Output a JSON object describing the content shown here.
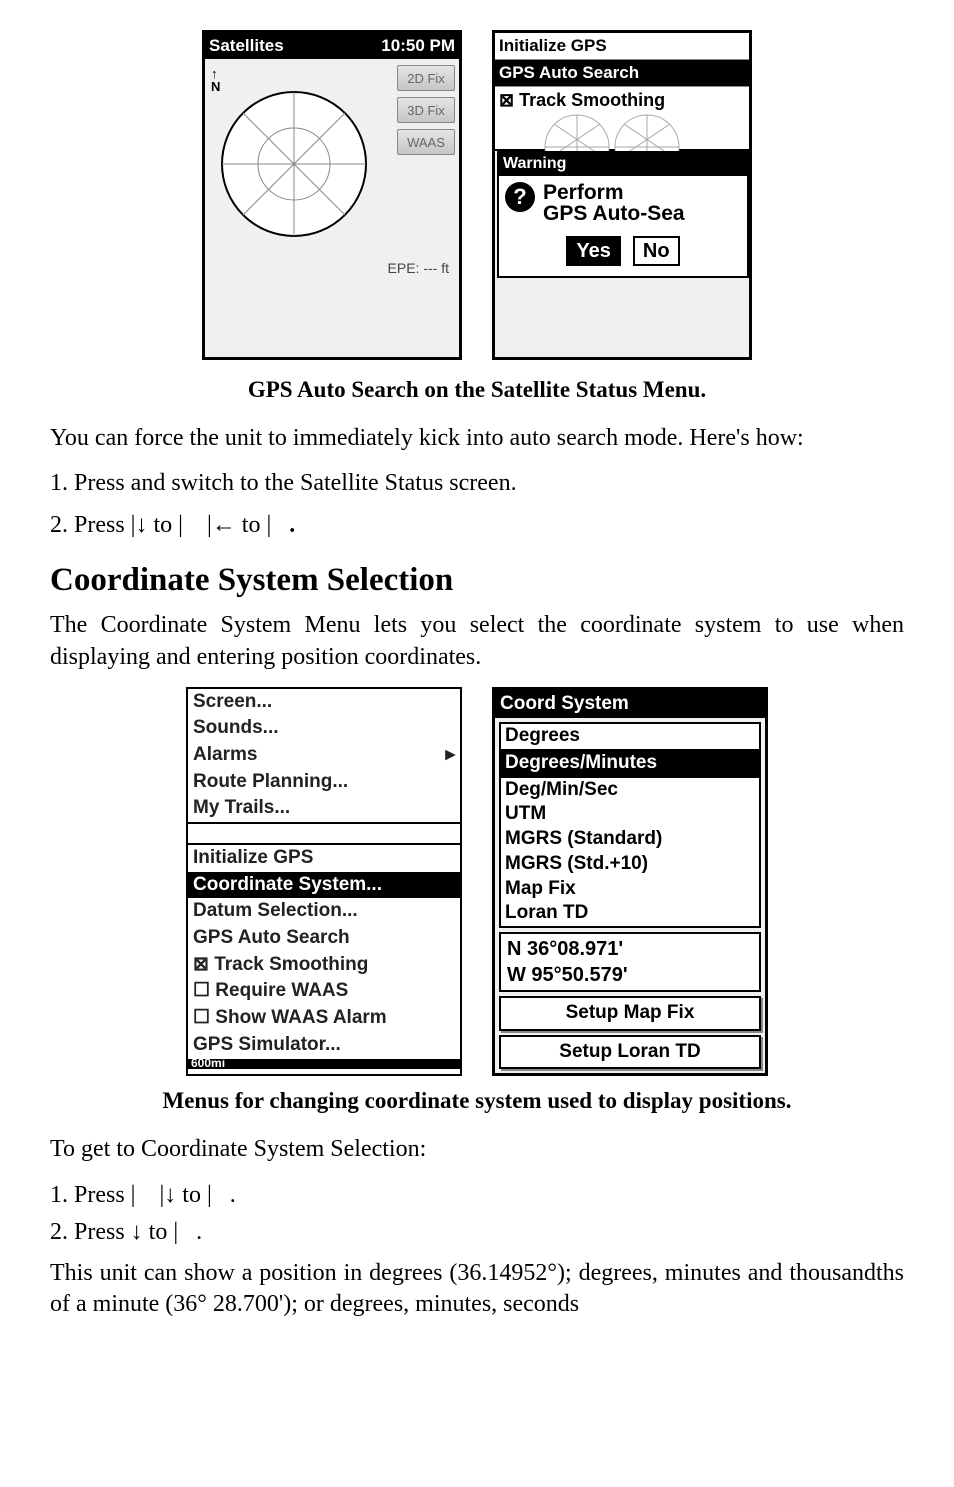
{
  "sat_screen": {
    "title_left": "Satellites",
    "title_right": "10:50 PM",
    "n_label": "N",
    "btn_2d": "2D Fix",
    "btn_3d": "3D Fix",
    "btn_waas": "WAAS",
    "epe": "EPE: --- ft"
  },
  "init_screen": {
    "item1": "Initialize GPS",
    "item2": "GPS Auto Search",
    "item3": "⊠ Track Smoothing",
    "warning_title": "Warning",
    "warning_line1": "Perform",
    "warning_line2": "GPS Auto-Sea",
    "btn_yes": "Yes",
    "btn_no": "No"
  },
  "caption1": "GPS Auto Search on the Satellite Status Menu.",
  "para1": "You can force the unit to immediately kick into auto search mode. Here's how:",
  "step1_pre": "1. Press ",
  "step1_post": " and switch to the Satellite Status screen.",
  "step2_a": "2. Press ",
  "step2_b": "|",
  "step2_c": " to ",
  "step2_d": "|",
  "step2_e": "|",
  "step2_f": " to ",
  "step2_g": "|",
  "step2_h": ".",
  "heading": "Coordinate System Selection",
  "para2": "The Coordinate System Menu lets you select the coordinate system to use when displaying and entering position coordinates.",
  "menu1": {
    "items": [
      "Screen...",
      "Sounds...",
      "Alarms",
      "Route Planning...",
      "My Trails..."
    ],
    "scroll_top": "",
    "items2": [
      "Initialize GPS"
    ],
    "selected": "Coordinate System...",
    "items3": [
      "Datum Selection...",
      "GPS Auto Search",
      "⊠ Track Smoothing",
      "☐ Require WAAS",
      "☐ Show WAAS Alarm",
      "GPS Simulator..."
    ],
    "footer": "600mi"
  },
  "coord_menu": {
    "title": "Coord System",
    "items_before": [
      "Degrees"
    ],
    "selected": "Degrees/Minutes",
    "items_after": [
      "Deg/Min/Sec",
      "UTM",
      "MGRS (Standard)",
      "MGRS (Std.+10)",
      "Map Fix",
      "Loran TD"
    ],
    "lat": "N   36°08.971'",
    "lon": "W   95°50.579'",
    "btn1": "Setup Map Fix",
    "btn2": "Setup Loran TD"
  },
  "caption2": "Menus for changing coordinate system used to display positions.",
  "para3": "To get to Coordinate System Selection:",
  "step_b1_a": "1. Press ",
  "step_b1_b": "|",
  "step_b1_c": "|",
  "step_b1_d": " to ",
  "step_b1_e": "|",
  "step_b1_f": ".",
  "step_b2_a": "2. Press ",
  "step_b2_b": " to ",
  "step_b2_c": "|",
  "step_b2_d": ".",
  "para4": "This unit can show a position in degrees (36.14952°); degrees, minutes and thousandths of a minute (36° 28.700'); or degrees, minutes, seconds"
}
